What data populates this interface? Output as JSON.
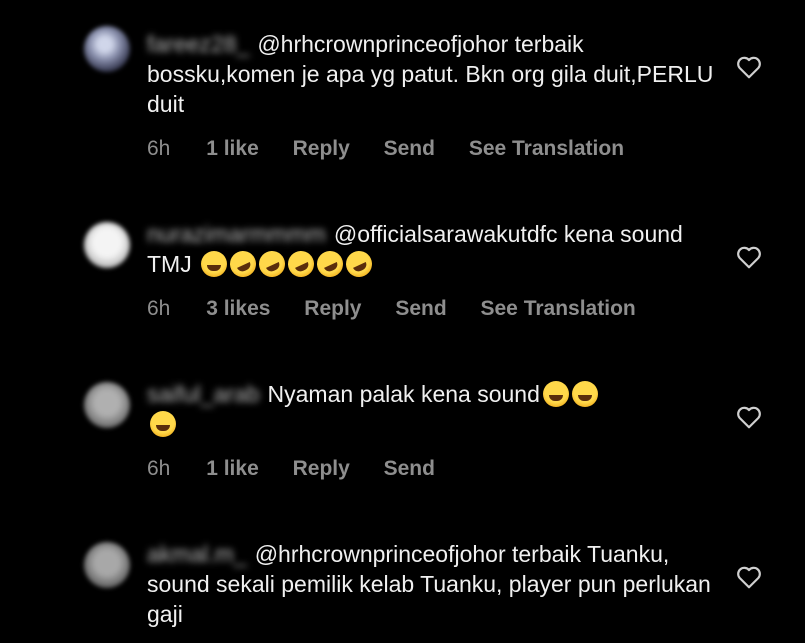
{
  "comments": [
    {
      "username": "fareez28_",
      "text": "@hrhcrownprinceofjohor terbaik bossku,komen je apa yg patut. Bkn org gila duit,PERLU duit",
      "emoji_count": 0,
      "time": "6h",
      "likes": "1 like",
      "actions": [
        "Reply",
        "Send",
        "See Translation"
      ]
    },
    {
      "username": "nurazimarmmmm",
      "text": "@officialsarawakutdfc kena sound TMJ",
      "emoji_count": 6,
      "time": "6h",
      "likes": "3 likes",
      "actions": [
        "Reply",
        "Send",
        "See Translation"
      ]
    },
    {
      "username": "saiful_arab",
      "text": "Nyaman palak kena sound",
      "emoji_count": 3,
      "time": "6h",
      "likes": "1 like",
      "actions": [
        "Reply",
        "Send"
      ]
    },
    {
      "username": "akmal.m_",
      "text": "@hrhcrownprinceofjohor terbaik Tuanku, sound sekali pemilik kelab Tuanku, player pun perlukan gaji",
      "emoji_count": 0,
      "time": "",
      "likes": "",
      "actions": []
    }
  ],
  "icons": {
    "like": "heart-outline-icon",
    "emoji": "laughing-emoji-icon"
  },
  "colors": {
    "background": "#000000",
    "text": "#f0f0f0",
    "meta": "#8e8e8e"
  }
}
